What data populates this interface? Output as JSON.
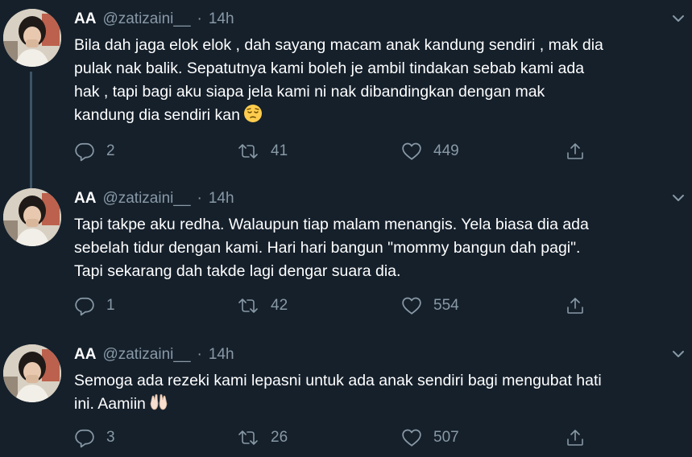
{
  "colors": {
    "background": "#15202b",
    "text": "#ffffff",
    "muted": "#8899a6",
    "thread_line": "#3d5466"
  },
  "tweets": [
    {
      "display_name": "AA",
      "handle": "@zatizaini__",
      "separator": "·",
      "time": "14h",
      "lines": [
        "Bila dah jaga elok elok , dah sayang macam anak kandung sendiri , mak dia",
        "pulak nak balik. Sepatutnya kami boleh je ambil tindakan sebab kami ada",
        "hak , tapi bagi aku siapa jela kami ni nak dibandingkan dengan mak",
        "kandung dia sendiri kan"
      ],
      "emoji": "pensive-face-emoji",
      "replies": "2",
      "retweets": "41",
      "likes": "449"
    },
    {
      "display_name": "AA",
      "handle": "@zatizaini__",
      "separator": "·",
      "time": "14h",
      "lines": [
        "Tapi takpe aku redha. Walaupun tiap malam menangis. Yela biasa dia ada",
        "sebelah tidur dengan kami. Hari hari bangun \"mommy bangun dah pagi\".",
        "Tapi sekarang dah takde lagi dengar suara dia."
      ],
      "replies": "1",
      "retweets": "42",
      "likes": "554"
    },
    {
      "display_name": "AA",
      "handle": "@zatizaini__",
      "separator": "·",
      "time": "14h",
      "lines": [
        "Semoga ada rezeki kami lepasni untuk ada anak sendiri bagi mengubat hati",
        "ini. Aamiin"
      ],
      "emoji": "raising-hands-emoji",
      "replies": "3",
      "retweets": "26",
      "likes": "507"
    }
  ],
  "icons": {
    "reply": "reply-icon",
    "retweet": "retweet-icon",
    "like": "heart-icon",
    "share": "share-icon",
    "menu": "chevron-down-icon"
  }
}
